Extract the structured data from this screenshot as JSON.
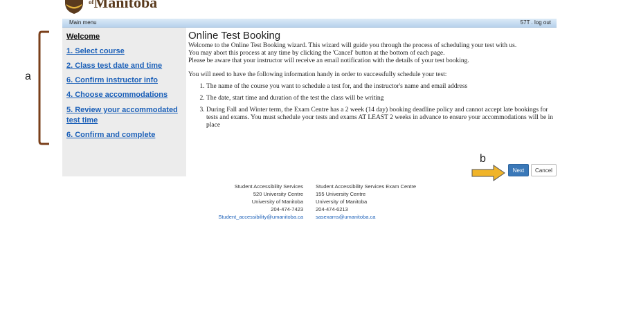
{
  "header": {
    "logo_text": "Manitoba",
    "logo_small": "of",
    "main_menu": "Main menu",
    "user_logout": "57T . log out"
  },
  "sidebar": {
    "items": [
      {
        "label": "Welcome"
      },
      {
        "label": "1. Select course"
      },
      {
        "label": "2. Class test date and time"
      },
      {
        "label": "6. Confirm instructor info"
      },
      {
        "label": "4. Choose accommodations"
      },
      {
        "label": "5. Review your accommodated"
      },
      {
        "label": "test time"
      },
      {
        "label": "6. Confirm and complete"
      }
    ]
  },
  "main": {
    "title": "Online Test Booking",
    "intro": [
      "Welcome to the Online Test Booking wizard. This wizard will guide you through the process of scheduling your test with us.",
      "You may abort this process at any time by clicking the 'Cancel' button at the bottom of each page.",
      "Please be aware that your instructor will receive an email notification with the details of your test booking."
    ],
    "need_text": "You will need to have the following information handy in order to successfully schedule your test:",
    "list": [
      "The name of the course you want to schedule a test for, and the instructor's name and email address",
      "The date, start time and duration of the test the class will be writing",
      "During Fall and Winter term, the Exam Centre has a 2 week (14 day) booking deadline policy and cannot accept late bookings for tests and exams. You must schedule your tests and exams AT LEAST 2 weeks in advance to ensure your accommodations will be in place"
    ]
  },
  "buttons": {
    "next": "Next",
    "cancel": "Cancel"
  },
  "footer": {
    "left": [
      "Student Accessibility Services",
      "520 University Centre",
      "University of Manitoba",
      "204-474-7423",
      "Student_accessibility@umanitoba.ca"
    ],
    "right": [
      "Student Accessibility Services Exam Centre",
      "155 University Centre",
      "University of Manitoba",
      "204-474-6213",
      "sasexams@umanitoba.ca"
    ]
  },
  "annotations": {
    "a": "a",
    "b": "b"
  },
  "colors": {
    "link": "#1a5fb8",
    "primary_button": "#3a78b8",
    "bracket": "#7a3f1a",
    "arrow": "#f0b429"
  }
}
